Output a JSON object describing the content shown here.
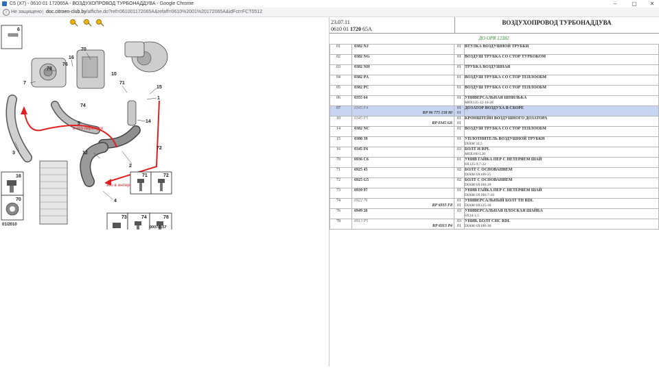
{
  "window": {
    "title": "C5 (X7) - 0610 01 172065A - ВОЗДУХОПРОВОД ТУРБОНАДДУВА - Google Chrome",
    "controls": [
      "–",
      "▢",
      "✕"
    ]
  },
  "address": {
    "security_label": "Не защищено",
    "host": "doc.citroen-club.by",
    "path": "/affiche.do?ref=061001172065A&refaff=0610%2001%20172065A&idFct=FCT0512"
  },
  "diagram": {
    "callouts": [
      "6",
      "70",
      "76",
      "16",
      "78",
      "7",
      "74",
      "10",
      "71",
      "15",
      "14",
      "5",
      "12",
      "3",
      "72",
      "2",
      "4",
      "1"
    ],
    "annotation_bypass": "в это перепуск",
    "annotation_intercooler": "это в интеркулер",
    "inset_numbers": [
      "16",
      "70",
      "71",
      "72",
      "73",
      "74",
      "78"
    ],
    "date_code": "01/2010",
    "ref_code": "00078157",
    "top_icons": [
      "key-icon",
      "key-icon",
      "key-icon"
    ]
  },
  "header": {
    "date": "23.07.11",
    "ref_prefix": "0610 01",
    "ref_bold": "1720",
    "ref_suffix": "65A",
    "title": "ВОЗДУХОПРОВОД ТУРБОНАДДУВА",
    "opr": "ДО OPR 12382"
  },
  "parts": [
    {
      "num": "01",
      "pn": "0382 NJ",
      "rp": "",
      "qty": "01",
      "qty2": "",
      "desc": "ВТУЛКА ВОЗДУШНОЙ ТРУБКИ",
      "desc2": "",
      "italic": false,
      "selected": false
    },
    {
      "num": "02",
      "pn": "0382 NG",
      "rp": "",
      "qty": "01",
      "qty2": "",
      "desc": "ВОЗДУШ ТРУБКА СО СТОР ТУРБОКОМ",
      "desc2": "",
      "italic": false,
      "selected": false
    },
    {
      "num": "03",
      "pn": "0382 NH",
      "rp": "",
      "qty": "01",
      "qty2": "",
      "desc": "ТРУБКА ВОЗДУШНАЯ",
      "desc2": "",
      "italic": false,
      "selected": false
    },
    {
      "num": "04",
      "pn": "0382 PA",
      "rp": "",
      "qty": "01",
      "qty2": "",
      "desc": "ВОЗДУШ ТРУБКА СО СТОР ТЕПЛООБМ",
      "desc2": "",
      "italic": false,
      "selected": false
    },
    {
      "num": "05",
      "pn": "0382 PC",
      "rp": "",
      "qty": "01",
      "qty2": "",
      "desc": "ВОЗДУШ ТРУБКА СО СТОР ТЕПЛООБМ",
      "desc2": "",
      "italic": false,
      "selected": false
    },
    {
      "num": "06",
      "pn": "0355 64",
      "rp": "",
      "qty": "01",
      "qty2": "",
      "desc": "УНИВЕРСАЛЬНАЯ ШПИЛЬКА",
      "desc2": "M8X125-12-10-28",
      "italic": false,
      "selected": false
    },
    {
      "num": "07",
      "pn": "0345 F4",
      "rp": "RP 96 775 158 80",
      "qty": "01",
      "qty2": "01",
      "desc": "ДОЗАТОР ВОЗДУХА В СБОРЕ",
      "desc2": "",
      "italic": true,
      "selected": true
    },
    {
      "num": "10",
      "pn": "0345 F5",
      "rp": "RP 0345 G6",
      "qty": "01",
      "qty2": "01",
      "desc": "КРОНШТЕЙН ВОЗДУШНОГО ДОЗАТОРА",
      "desc2": "",
      "italic": true,
      "selected": false
    },
    {
      "num": "14",
      "pn": "0382 NC",
      "rp": "",
      "qty": "01",
      "qty2": "",
      "desc": "ВОЗДУШ ТРУБКА СО СТОР ТЕПЛООБМ",
      "desc2": "",
      "italic": false,
      "selected": false
    },
    {
      "num": "15",
      "pn": "0380 39",
      "rp": "",
      "qty": "01",
      "qty2": "",
      "desc": "УПЛОТНИТЕЛЬ ВОЗДУШНОЙ ТРУБКИ",
      "desc2": "DIAM 32,5",
      "italic": false,
      "selected": false
    },
    {
      "num": "16",
      "pn": "0345 F6",
      "rp": "",
      "qty": "03",
      "qty2": "",
      "desc": "БОЛТ Н RPL",
      "desc2": "M6X100 L30",
      "italic": false,
      "selected": false
    },
    {
      "num": "70",
      "pn": "6936 C6",
      "rp": "",
      "qty": "01",
      "qty2": "",
      "desc": "УНИВ ГАЙКА ПЕР С НЕТЕРЯЕМ ШАЙ",
      "desc2": "8X125-9,7-22",
      "italic": false,
      "selected": false
    },
    {
      "num": "71",
      "pn": "6925 45",
      "rp": "",
      "qty": "02",
      "qty2": "",
      "desc": "БОЛТ С ОСНОВАНИЕМ",
      "desc2": "DIAM 6X100-25",
      "italic": false,
      "selected": false
    },
    {
      "num": "72",
      "pn": "6925 G5",
      "rp": "",
      "qty": "02",
      "qty2": "",
      "desc": "БОЛТ С ОСНОВАНИЕМ",
      "desc2": "DIAM 6X100-20",
      "italic": false,
      "selected": false
    },
    {
      "num": "73",
      "pn": "6939 97",
      "rp": "",
      "qty": "01",
      "qty2": "",
      "desc": "УНИВ ГАЙКА ПЕР С НЕТЕРЯЕМ ШАЙ",
      "desc2": "DIAM 6X100-7-18",
      "italic": false,
      "selected": false
    },
    {
      "num": "74",
      "pn": "6922 76",
      "rp": "RP 6933 F8",
      "qty": "01",
      "qty2": "01",
      "desc": "УНИВЕРСАЛЬНЫЙ БОЛТ ТН RDL",
      "desc2": "DIAM 8X125-30",
      "italic": true,
      "selected": false
    },
    {
      "num": "76",
      "pn": "6949 26",
      "rp": "",
      "qty": "03",
      "qty2": "",
      "desc": "УНИВЕРСАЛЬНАЯ ПЛОСКАЯ ШАЙБА",
      "desc2": "6X34-1,5",
      "italic": false,
      "selected": false
    },
    {
      "num": "78",
      "pn": "6913 P5",
      "rp": "RP 6913 P4",
      "qty": "03",
      "qty2": "01",
      "desc": "УНИВ. БОЛТ CHC RDL",
      "desc2": "DIAM 6X100-30",
      "italic": true,
      "selected": false
    }
  ]
}
